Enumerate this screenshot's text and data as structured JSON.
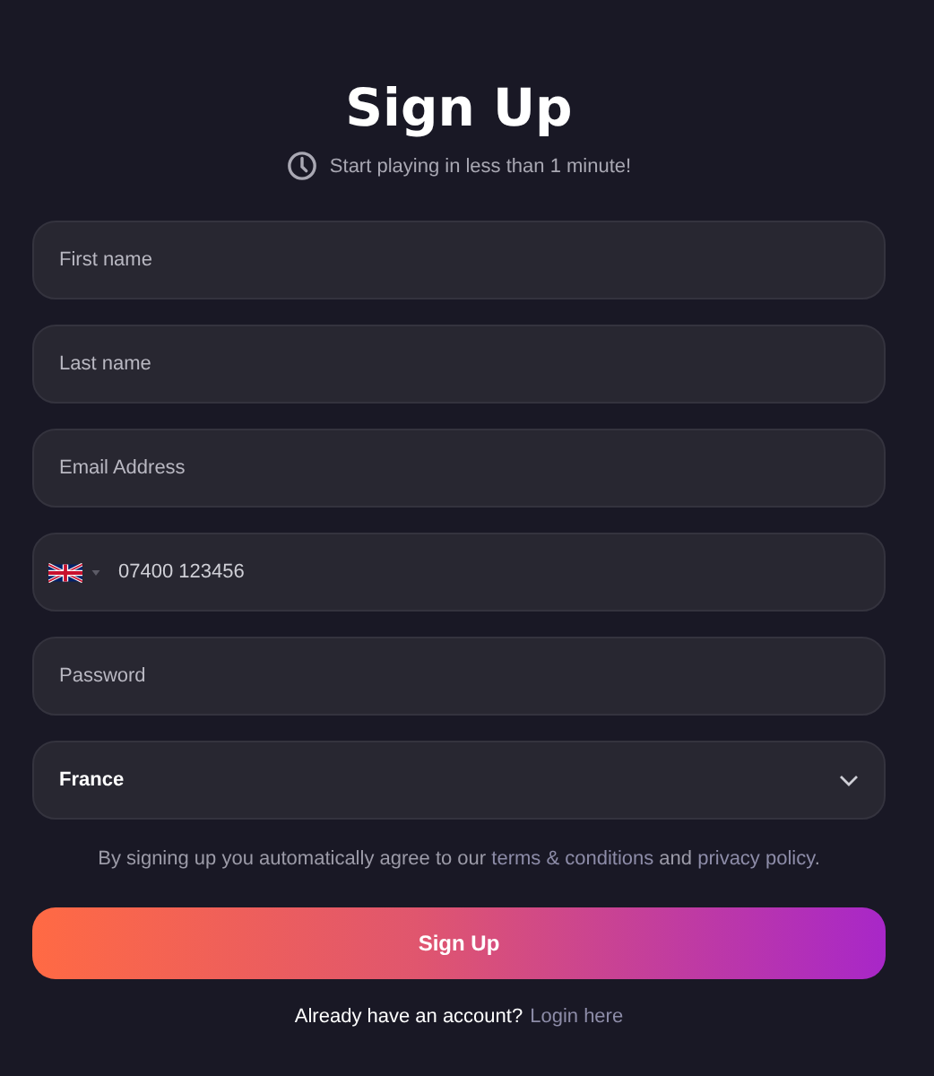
{
  "title": "Sign Up",
  "subtitle": "Start playing in less than 1 minute!",
  "fields": [
    {
      "kind": "text",
      "placeholder": "First name"
    },
    {
      "kind": "text",
      "placeholder": "Last name"
    },
    {
      "kind": "text",
      "placeholder": "Email Address"
    },
    {
      "kind": "phone",
      "value": "07400 123456"
    },
    {
      "kind": "password",
      "placeholder": "Password"
    },
    {
      "kind": "select",
      "value": "France"
    }
  ],
  "terms": {
    "before": "By signing up you automatically agree to our",
    "link_1": "terms & conditions",
    "middle": "and",
    "link_2": "privacy policy",
    "after": "."
  },
  "submit": "Sign Up",
  "login": {
    "prompt": "Already have an account?",
    "link": "Login here"
  }
}
